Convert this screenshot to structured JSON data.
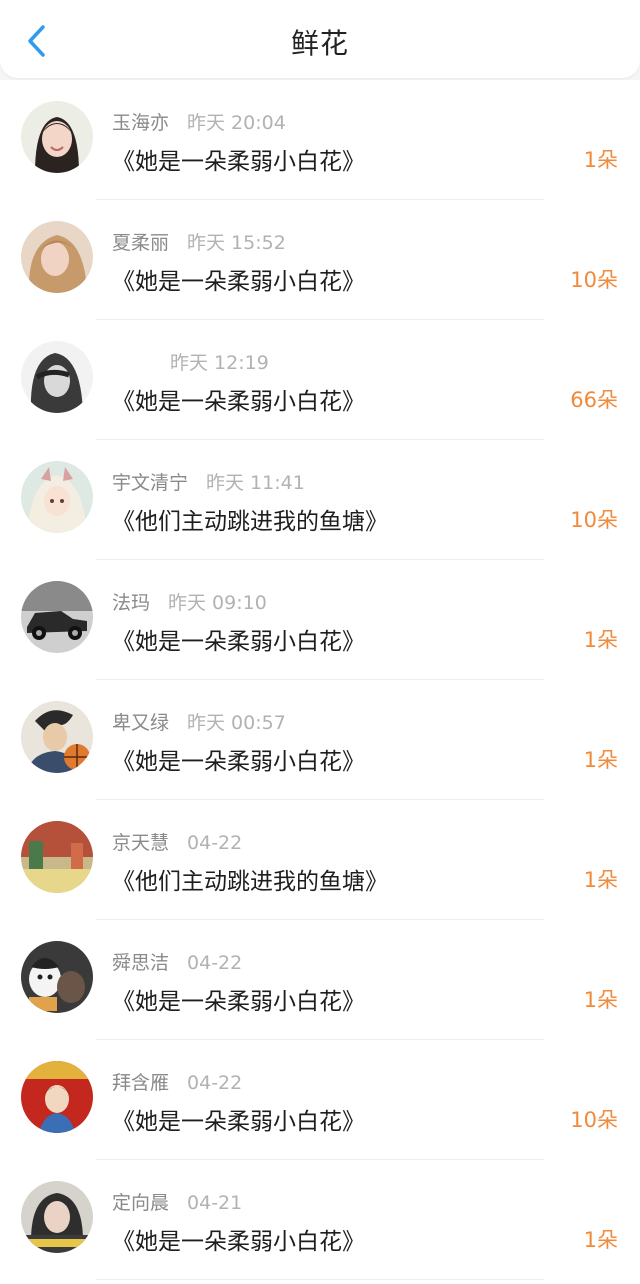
{
  "header": {
    "title": "鲜花",
    "back_icon": "chevron-left-icon"
  },
  "colors": {
    "accent": "#2f9bf0",
    "count": "#f08a3a",
    "time": "#b2b2b2"
  },
  "items": [
    {
      "name": "玉海亦",
      "time": "昨天 20:04",
      "book": "《她是一朵柔弱小白花》",
      "count": "1朵",
      "avatar": "portrait-avatar-girl"
    },
    {
      "name": "夏柔丽",
      "time": "昨天 15:52",
      "book": "《她是一朵柔弱小白花》",
      "count": "10朵",
      "avatar": "portrait-avatar-blonde"
    },
    {
      "name": "",
      "time": "昨天 12:19",
      "book": "《她是一朵柔弱小白花》",
      "count": "66朵",
      "avatar": "portrait-avatar-mono"
    },
    {
      "name": "宇文清宁",
      "time": "昨天 11:41",
      "book": "《他们主动跳进我的鱼塘》",
      "count": "10朵",
      "avatar": "anime-avatar"
    },
    {
      "name": "法玛",
      "time": "昨天 09:10",
      "book": "《她是一朵柔弱小白花》",
      "count": "1朵",
      "avatar": "vintage-car-avatar"
    },
    {
      "name": "卑又绿",
      "time": "昨天 00:57",
      "book": "《她是一朵柔弱小白花》",
      "count": "1朵",
      "avatar": "basketball-avatar"
    },
    {
      "name": "京天慧",
      "time": "04-22",
      "book": "《他们主动跳进我的鱼塘》",
      "count": "1朵",
      "avatar": "scene-avatar"
    },
    {
      "name": "舜思洁",
      "time": "04-22",
      "book": "《她是一朵柔弱小白花》",
      "count": "1朵",
      "avatar": "dog-avatar"
    },
    {
      "name": "拜含雁",
      "time": "04-22",
      "book": "《她是一朵柔弱小白花》",
      "count": "10朵",
      "avatar": "poster-avatar"
    },
    {
      "name": "定向晨",
      "time": "04-21",
      "book": "《她是一朵柔弱小白花》",
      "count": "1朵",
      "avatar": "selfie-avatar"
    }
  ]
}
